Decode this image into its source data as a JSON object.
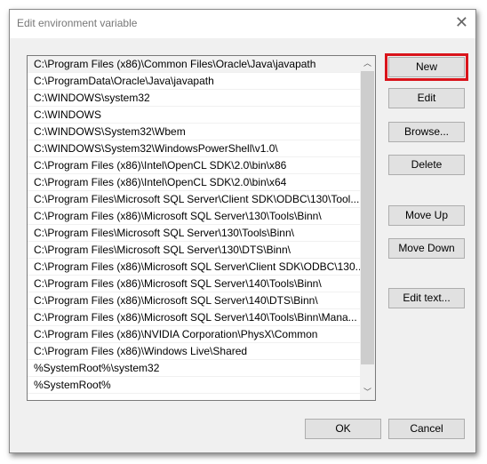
{
  "window": {
    "title": "Edit environment variable",
    "close_icon": "close-icon"
  },
  "paths": [
    "C:\\Program Files (x86)\\Common Files\\Oracle\\Java\\javapath",
    "C:\\ProgramData\\Oracle\\Java\\javapath",
    "C:\\WINDOWS\\system32",
    "C:\\WINDOWS",
    "C:\\WINDOWS\\System32\\Wbem",
    "C:\\WINDOWS\\System32\\WindowsPowerShell\\v1.0\\",
    "C:\\Program Files (x86)\\Intel\\OpenCL SDK\\2.0\\bin\\x86",
    "C:\\Program Files (x86)\\Intel\\OpenCL SDK\\2.0\\bin\\x64",
    "C:\\Program Files\\Microsoft SQL Server\\Client SDK\\ODBC\\130\\Tool...",
    "C:\\Program Files (x86)\\Microsoft SQL Server\\130\\Tools\\Binn\\",
    "C:\\Program Files\\Microsoft SQL Server\\130\\Tools\\Binn\\",
    "C:\\Program Files\\Microsoft SQL Server\\130\\DTS\\Binn\\",
    "C:\\Program Files (x86)\\Microsoft SQL Server\\Client SDK\\ODBC\\130...",
    "C:\\Program Files (x86)\\Microsoft SQL Server\\140\\Tools\\Binn\\",
    "C:\\Program Files (x86)\\Microsoft SQL Server\\140\\DTS\\Binn\\",
    "C:\\Program Files (x86)\\Microsoft SQL Server\\140\\Tools\\Binn\\Mana...",
    "C:\\Program Files (x86)\\NVIDIA Corporation\\PhysX\\Common",
    "C:\\Program Files (x86)\\Windows Live\\Shared",
    "%SystemRoot%\\system32",
    "%SystemRoot%"
  ],
  "buttons": {
    "new": "New",
    "edit": "Edit",
    "browse": "Browse...",
    "delete": "Delete",
    "move_up": "Move Up",
    "move_down": "Move Down",
    "edit_text": "Edit text...",
    "ok": "OK",
    "cancel": "Cancel"
  },
  "highlight_color": "#d9141b"
}
